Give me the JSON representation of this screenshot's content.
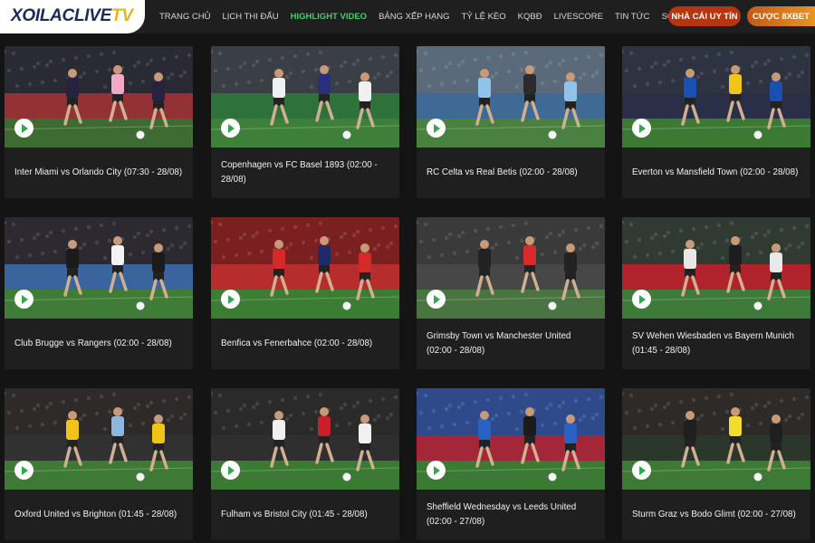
{
  "header": {
    "logo_main": "XOILACLIVE",
    "logo_accent": "TV",
    "nav": [
      {
        "label": "TRANG CHỦ",
        "active": false
      },
      {
        "label": "LỊCH THI ĐẤU",
        "active": false
      },
      {
        "label": "HIGHLIGHT VIDEO",
        "active": true
      },
      {
        "label": "BẢNG XẾP HẠNG",
        "active": false
      },
      {
        "label": "TỶ LỆ KÈO",
        "active": false
      },
      {
        "label": "KQBĐ",
        "active": false
      },
      {
        "label": "LIVESCORE",
        "active": false
      },
      {
        "label": "TIN TỨC",
        "active": false
      },
      {
        "label": "SOI KÈO",
        "active": false
      }
    ],
    "btn_nhacai": "NHÀ CÁI UY TÍN",
    "btn_cuoc": "CƯỢC 8XBET"
  },
  "videos": [
    {
      "title": "Inter Miami vs Orlando City (07:30 - 28/08)",
      "pitch": "#3d6b32",
      "crowd": "#2a2a35",
      "home": "#25233f",
      "away": "#f2a8c6",
      "ad": "#a63434"
    },
    {
      "title": "Copenhagen vs FC Basel 1893 (02:00 - 28/08)",
      "pitch": "#3e7f3a",
      "crowd": "#3a3f46",
      "home": "#f0f0f0",
      "away": "#2a2f7a",
      "ad": "#2e7a3a"
    },
    {
      "title": "RC Celta vs Real Betis (02:00 - 28/08)",
      "pitch": "#4a8040",
      "crowd": "#5a6a7a",
      "home": "#8fc4e8",
      "away": "#2b2b2b",
      "ad": "#3a6a9a"
    },
    {
      "title": "Everton vs Mansfield Town (02:00 - 28/08)",
      "pitch": "#3c7a34",
      "crowd": "#2d3340",
      "home": "#1a4fb3",
      "away": "#f0c419",
      "ad": "#2a2f4a"
    },
    {
      "title": "Club Brugge vs Rangers (02:00 - 28/08)",
      "pitch": "#3f7c37",
      "crowd": "#2c2a30",
      "home": "#1b1b1b",
      "away": "#f2f2f2",
      "ad": "#3c6fb0"
    },
    {
      "title": "Benfica vs Fenerbahce (02:00 - 28/08)",
      "pitch": "#3a7d33",
      "crowd": "#7a2020",
      "home": "#d42a2a",
      "away": "#1c2a6a",
      "ad": "#c23030"
    },
    {
      "title": "Grimsby Town vs Manchester United (02:00 - 28/08)",
      "pitch": "#4a7542",
      "crowd": "#3a3a3a",
      "home": "#222222",
      "away": "#d92b2b",
      "ad": "#4a4a4a"
    },
    {
      "title": "SV Wehen Wiesbaden vs Bayern Munich (01:45 - 28/08)",
      "pitch": "#3e7a38",
      "crowd": "#2f3a33",
      "home": "#e8e8e8",
      "away": "#1d1d1d",
      "ad": "#c8202a"
    },
    {
      "title": "Oxford United vs Brighton (01:45 - 28/08)",
      "pitch": "#3e7a35",
      "crowd": "#2e2a2a",
      "home": "#f2c417",
      "away": "#8ab8e0",
      "ad": "#333333"
    },
    {
      "title": "Fulham vs Bristol City (01:45 - 28/08)",
      "pitch": "#3b7a33",
      "crowd": "#2a2a2a",
      "home": "#f0f0f0",
      "away": "#c8202a",
      "ad": "#303030"
    },
    {
      "title": "Sheffield Wednesday vs Leeds United (02:00 - 27/08)",
      "pitch": "#3a7a32",
      "crowd": "#2f4a8a",
      "home": "#2a62c4",
      "away": "#1a1a1a",
      "ad": "#b8202a"
    },
    {
      "title": "Sturm Graz vs Bodo Glimt (02:00 - 27/08)",
      "pitch": "#3d7a36",
      "crowd": "#2d2a28",
      "home": "#1f1f1f",
      "away": "#f2de2a",
      "ad": "#2a3a2a"
    }
  ]
}
